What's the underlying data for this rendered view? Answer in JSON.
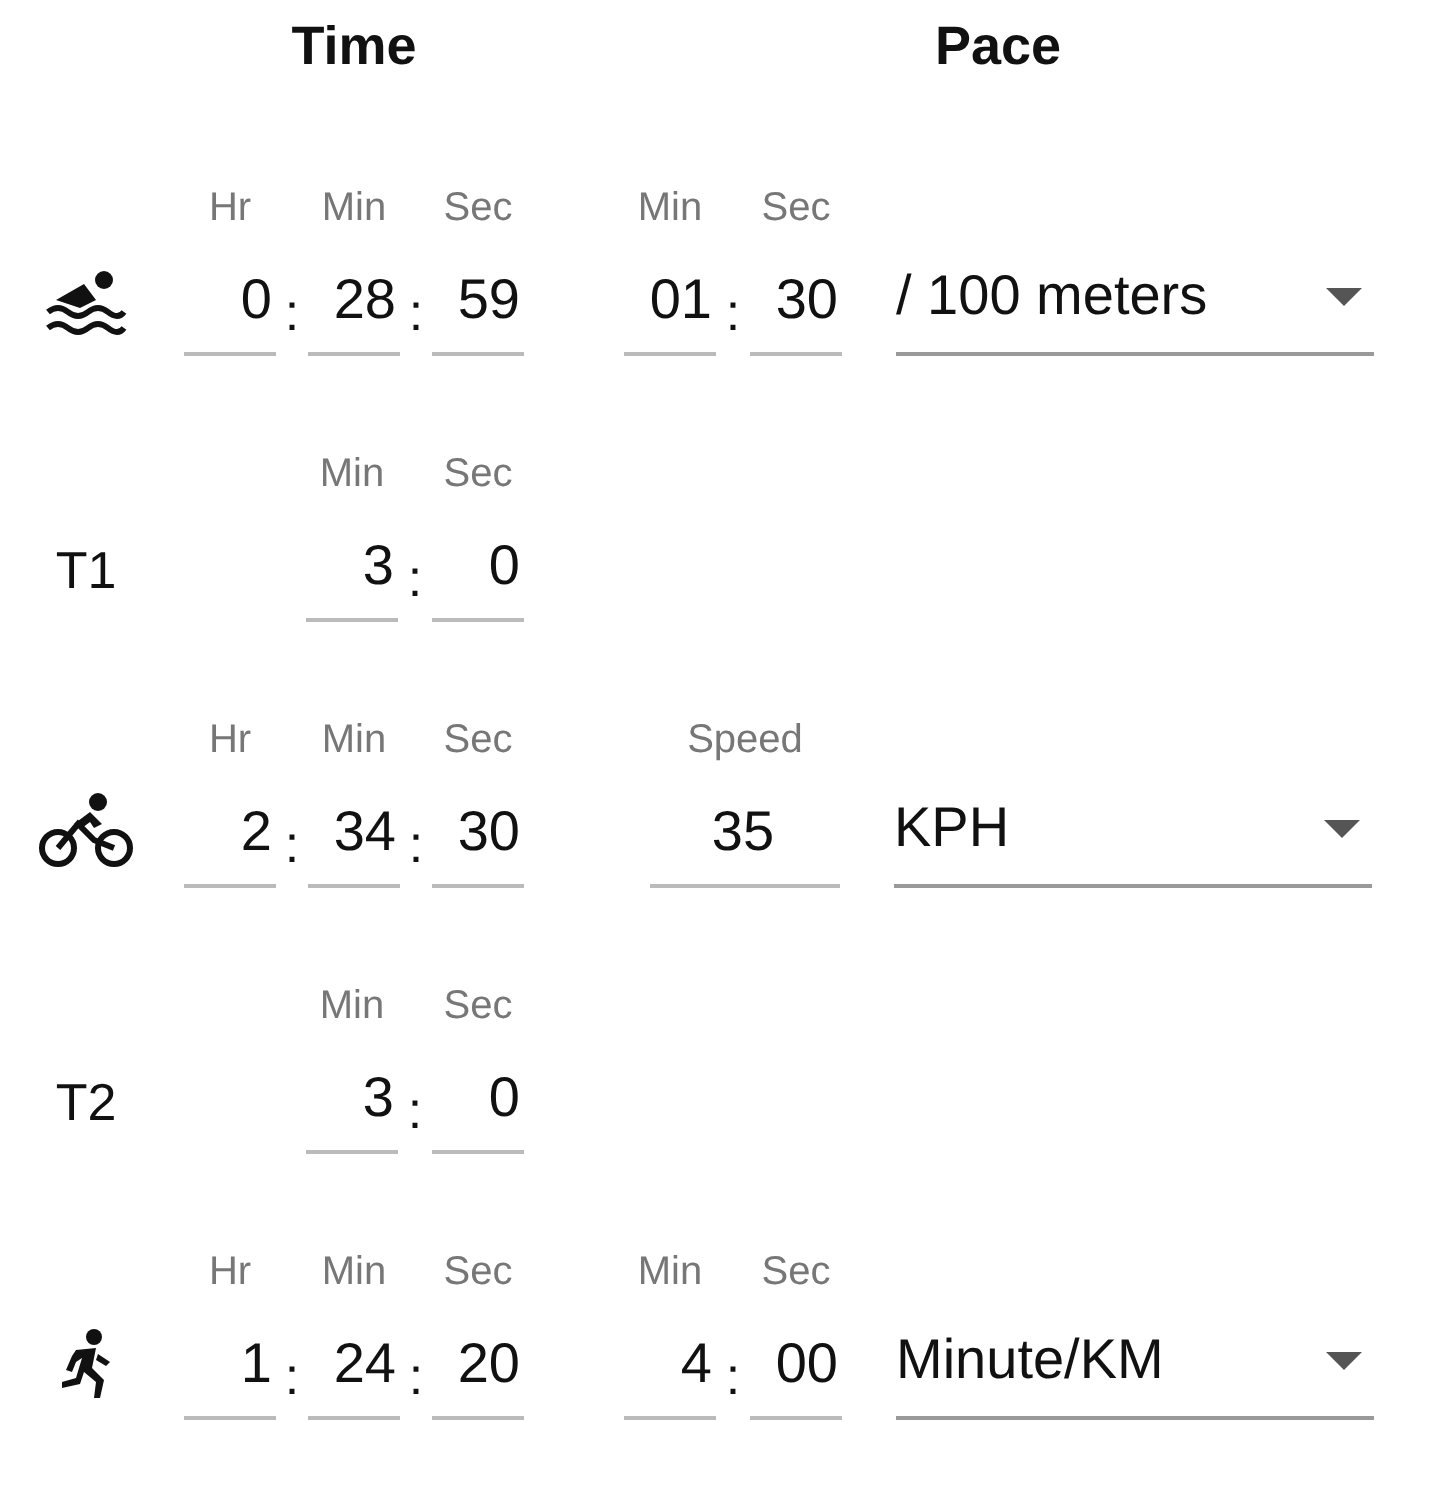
{
  "time_heading": "Time",
  "pace_heading": "Pace",
  "separator": ":",
  "segments": [
    {
      "kind": "swim",
      "time": [
        {
          "label": "Hr",
          "value": "0"
        },
        {
          "label": "Min",
          "value": "28"
        },
        {
          "label": "Sec",
          "value": "59"
        }
      ],
      "pace": {
        "kind": "split",
        "fields": [
          {
            "label": "Min",
            "value": "01"
          },
          {
            "label": "Sec",
            "value": "30"
          }
        ],
        "unit": "/ 100 meters"
      }
    },
    {
      "kind": "transition",
      "label": "T1",
      "time": [
        {
          "label": "Min",
          "value": "3"
        },
        {
          "label": "Sec",
          "value": "0"
        }
      ]
    },
    {
      "kind": "bike",
      "time": [
        {
          "label": "Hr",
          "value": "2"
        },
        {
          "label": "Min",
          "value": "34"
        },
        {
          "label": "Sec",
          "value": "30"
        }
      ],
      "pace": {
        "kind": "speed",
        "fields": [
          {
            "label": "Speed",
            "value": "35"
          }
        ],
        "unit": "KPH"
      }
    },
    {
      "kind": "transition",
      "label": "T2",
      "time": [
        {
          "label": "Min",
          "value": "3"
        },
        {
          "label": "Sec",
          "value": "0"
        }
      ]
    },
    {
      "kind": "run",
      "time": [
        {
          "label": "Hr",
          "value": "1"
        },
        {
          "label": "Min",
          "value": "24"
        },
        {
          "label": "Sec",
          "value": "20"
        }
      ],
      "pace": {
        "kind": "split",
        "fields": [
          {
            "label": "Min",
            "value": "4"
          },
          {
            "label": "Sec",
            "value": "00"
          }
        ],
        "unit": "Minute/KM"
      }
    }
  ]
}
